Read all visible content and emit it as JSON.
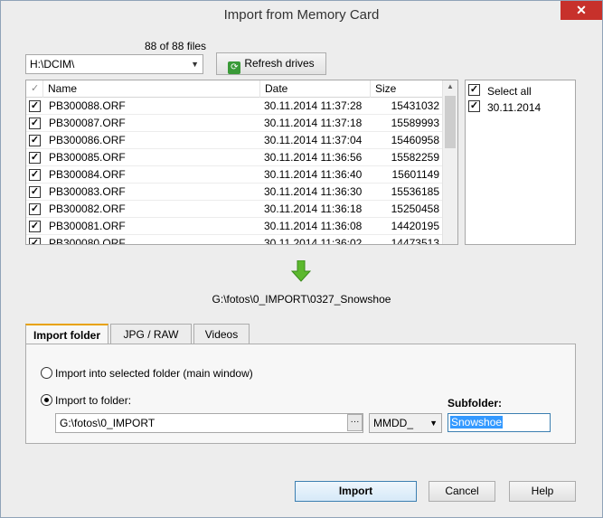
{
  "window": {
    "title": "Import from Memory Card",
    "close_label": "✕"
  },
  "source": {
    "file_count": "88 of 88 files",
    "drive": "H:\\DCIM\\",
    "refresh_label": "Refresh drives"
  },
  "file_list": {
    "columns": [
      "Name",
      "Date",
      "Size"
    ],
    "rows": [
      {
        "name": "PB300088.ORF",
        "date": "30.11.2014 11:37:28",
        "size": "15431032",
        "checked": true
      },
      {
        "name": "PB300087.ORF",
        "date": "30.11.2014 11:37:18",
        "size": "15589993",
        "checked": true
      },
      {
        "name": "PB300086.ORF",
        "date": "30.11.2014 11:37:04",
        "size": "15460958",
        "checked": true
      },
      {
        "name": "PB300085.ORF",
        "date": "30.11.2014 11:36:56",
        "size": "15582259",
        "checked": true
      },
      {
        "name": "PB300084.ORF",
        "date": "30.11.2014 11:36:40",
        "size": "15601149",
        "checked": true
      },
      {
        "name": "PB300083.ORF",
        "date": "30.11.2014 11:36:30",
        "size": "15536185",
        "checked": true
      },
      {
        "name": "PB300082.ORF",
        "date": "30.11.2014 11:36:18",
        "size": "15250458",
        "checked": true
      },
      {
        "name": "PB300081.ORF",
        "date": "30.11.2014 11:36:08",
        "size": "14420195",
        "checked": true
      },
      {
        "name": "PB300080.ORF",
        "date": "30.11.2014 11:36:02",
        "size": "14473513",
        "checked": true
      }
    ]
  },
  "date_filter": {
    "items": [
      {
        "label": "Select all",
        "checked": true
      },
      {
        "label": "30.11.2014",
        "checked": true
      }
    ]
  },
  "target": {
    "path": "G:\\fotos\\0_IMPORT\\0327_Snowshoe"
  },
  "tabs": [
    {
      "label": "Import folder",
      "active": true
    },
    {
      "label": "JPG / RAW",
      "active": false
    },
    {
      "label": "Videos",
      "active": false
    }
  ],
  "import_folder": {
    "option_selected_folder": "Import into selected folder (main window)",
    "option_to_folder": "Import to folder:",
    "folder_value": "G:\\fotos\\0_IMPORT",
    "browse_label": "···",
    "format_value": "MMDD_",
    "subfolder_title": "Subfolder:",
    "subfolder_value": "Snowshoe"
  },
  "buttons": {
    "import": "Import",
    "cancel": "Cancel",
    "help": "Help"
  },
  "colors": {
    "accent_tab": "#e8a200",
    "arrow": "#5cb82e",
    "close": "#c7312b"
  }
}
